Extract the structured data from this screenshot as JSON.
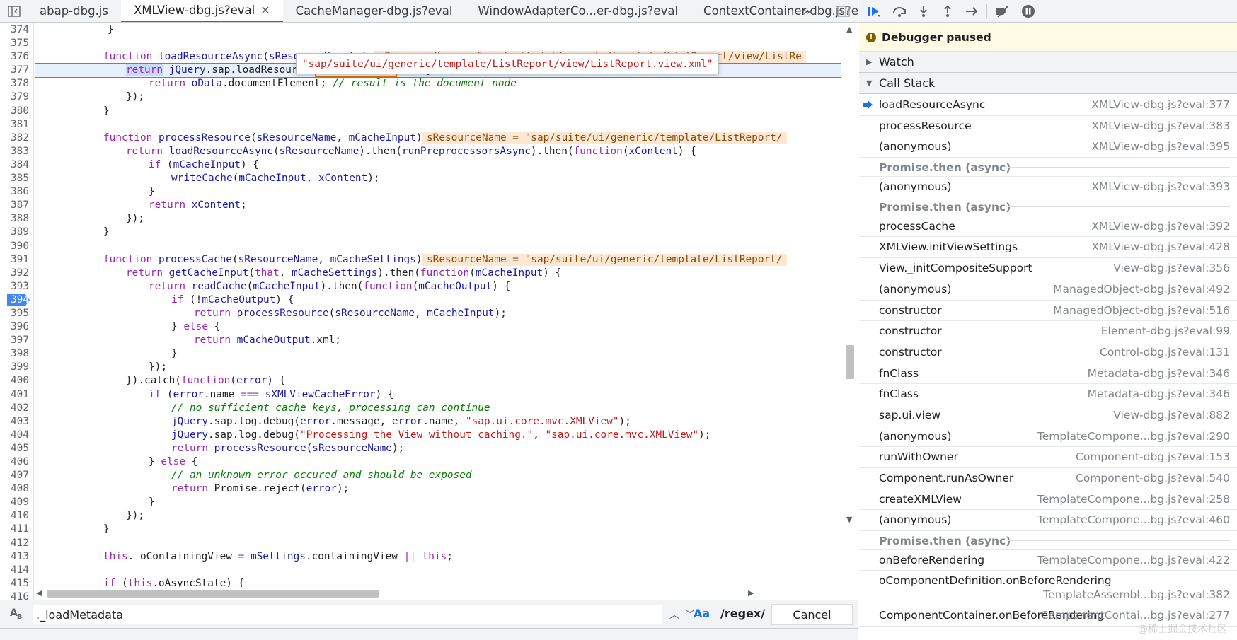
{
  "tabs": [
    {
      "label": "abap-dbg.js",
      "active": false,
      "closable": false
    },
    {
      "label": "XMLView-dbg.js?eval",
      "active": true,
      "closable": true
    },
    {
      "label": "CacheManager-dbg.js?eval",
      "active": false,
      "closable": false
    },
    {
      "label": "WindowAdapterCo...er-dbg.js?eval",
      "active": false,
      "closable": false
    },
    {
      "label": "ContextContainer-dbg.js?eval",
      "active": false,
      "closable": false
    }
  ],
  "tabbar_icons": {
    "toggle_navigator": "sidebar-toggle-icon",
    "more_tabs": "double-chevron-right-icon",
    "toggle_debugger": "sidebar-right-toggle-icon"
  },
  "tooltip": "\"sap/suite/ui/generic/template/ListReport/view/ListReport.view.xml\"",
  "line_numbers": [
    "374",
    "375",
    "376",
    "377",
    "378",
    "379",
    "380",
    "381",
    "382",
    "383",
    "384",
    "385",
    "386",
    "387",
    "388",
    "389",
    "390",
    "391",
    "392",
    "393",
    "394",
    "395",
    "396",
    "397",
    "398",
    "399",
    "400",
    "401",
    "402",
    "403",
    "404",
    "405",
    "406",
    "407",
    "408",
    "409",
    "410",
    "411",
    "412",
    "413",
    "414",
    "415",
    "416"
  ],
  "breakpoint_line": "394",
  "inline_values": {
    "l376": "sResourceName = \"sap/suite/ui/generic/template/ListReport/view/ListRe",
    "l382": "sResourceName = \"sap/suite/ui/generic/template/ListReport/",
    "l391": "sResourceName = \"sap/suite/ui/generic/template/ListReport/"
  },
  "search": {
    "value": "._loadMetadata",
    "match_case_label": "Aa",
    "regex_label": "/regex/",
    "cancel_label": "Cancel"
  },
  "debugger": {
    "paused_label": "Debugger paused",
    "watch_label": "Watch",
    "call_stack_label": "Call Stack",
    "frames": [
      {
        "name": "loadResourceAsync",
        "loc": "XMLView-dbg.js?eval:377",
        "kind": "current"
      },
      {
        "name": "processResource",
        "loc": "XMLView-dbg.js?eval:383",
        "kind": "frame"
      },
      {
        "name": "(anonymous)",
        "loc": "XMLView-dbg.js?eval:395",
        "kind": "frame"
      },
      {
        "name": "Promise.then (async)",
        "loc": "",
        "kind": "async"
      },
      {
        "name": "(anonymous)",
        "loc": "XMLView-dbg.js?eval:393",
        "kind": "frame"
      },
      {
        "name": "Promise.then (async)",
        "loc": "",
        "kind": "async"
      },
      {
        "name": "processCache",
        "loc": "XMLView-dbg.js?eval:392",
        "kind": "frame"
      },
      {
        "name": "XMLView.initViewSettings",
        "loc": "XMLView-dbg.js?eval:428",
        "kind": "frame"
      },
      {
        "name": "View._initCompositeSupport",
        "loc": "View-dbg.js?eval:356",
        "kind": "frame"
      },
      {
        "name": "(anonymous)",
        "loc": "ManagedObject-dbg.js?eval:492",
        "kind": "frame"
      },
      {
        "name": "constructor",
        "loc": "ManagedObject-dbg.js?eval:516",
        "kind": "frame"
      },
      {
        "name": "constructor",
        "loc": "Element-dbg.js?eval:99",
        "kind": "frame"
      },
      {
        "name": "constructor",
        "loc": "Control-dbg.js?eval:131",
        "kind": "frame"
      },
      {
        "name": "fnClass",
        "loc": "Metadata-dbg.js?eval:346",
        "kind": "frame"
      },
      {
        "name": "fnClass",
        "loc": "Metadata-dbg.js?eval:346",
        "kind": "frame"
      },
      {
        "name": "sap.ui.view",
        "loc": "View-dbg.js?eval:882",
        "kind": "frame"
      },
      {
        "name": "(anonymous)",
        "loc": "TemplateCompone...bg.js?eval:290",
        "kind": "frame"
      },
      {
        "name": "runWithOwner",
        "loc": "Component-dbg.js?eval:153",
        "kind": "frame"
      },
      {
        "name": "Component.runAsOwner",
        "loc": "Component-dbg.js?eval:540",
        "kind": "frame"
      },
      {
        "name": "createXMLView",
        "loc": "TemplateCompone...bg.js?eval:258",
        "kind": "frame"
      },
      {
        "name": "(anonymous)",
        "loc": "TemplateCompone...bg.js?eval:460",
        "kind": "frame"
      },
      {
        "name": "Promise.then (async)",
        "loc": "",
        "kind": "async"
      },
      {
        "name": "onBeforeRendering",
        "loc": "TemplateCompone...bg.js?eval:422",
        "kind": "frame"
      },
      {
        "name": "oComponentDefinition.onBeforeRendering",
        "loc": "TemplateAssembl...bg.js?eval:382",
        "kind": "twoline"
      },
      {
        "name": "ComponentContainer.onBeforeRendering",
        "loc": "ComponentContai...bg.js?eval:277",
        "kind": "frame"
      }
    ],
    "watermark": "@稀土掘金技术社区"
  }
}
